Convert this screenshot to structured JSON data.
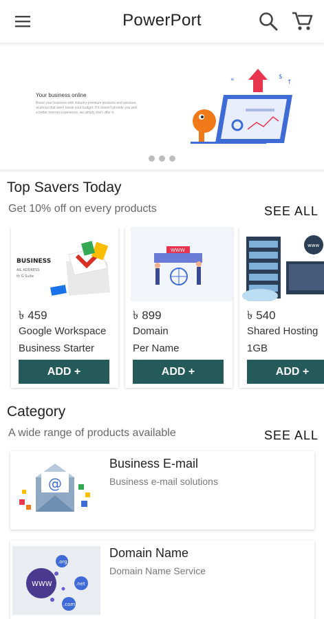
{
  "app": {
    "title": "PowerPort"
  },
  "icons": {
    "menu": "menu-icon",
    "search": "search-icon",
    "cart": "cart-icon"
  },
  "banner": {
    "heading": "Your business online",
    "body": "Boost your business with industry-premium products and services, at prices that won't break your budget. If it doesn't provide you with a better internet experience, we simply don't offer it.",
    "slides": 3,
    "active_slide": 1
  },
  "top_savers": {
    "title": "Top Savers Today",
    "subtitle": "Get 10% off on every products",
    "see_all": "SEE ALL",
    "products": [
      {
        "price": "৳ 459",
        "name": "Google Workspace",
        "variant": "Business Starter",
        "button": "ADD +",
        "image_text": [
          "BUSINESS",
          "AIL ADDRESS",
          "th G Suite"
        ]
      },
      {
        "price": "৳ 899",
        "name": "Domain",
        "variant": "Per Name",
        "button": "ADD +",
        "image_text": [
          "WWW"
        ]
      },
      {
        "price": "৳ 540",
        "name": "Shared Hosting",
        "variant": "1GB",
        "button": "ADD +",
        "image_text": [
          "www"
        ]
      }
    ]
  },
  "category": {
    "title": "Category",
    "subtitle": "A wide range of products available",
    "see_all": "SEE ALL",
    "items": [
      {
        "title": "Business E-mail",
        "subtitle": "Business e-mail solutions"
      },
      {
        "title": "Domain Name",
        "subtitle": "Domain Name Service",
        "image_text": [
          "WWW",
          ".org",
          ".net",
          ".com"
        ]
      }
    ]
  },
  "colors": {
    "primary_button": "#245a5a",
    "accent_blue": "#3f6bd6",
    "accent_red": "#e8344e",
    "accent_orange": "#f07a1a"
  }
}
